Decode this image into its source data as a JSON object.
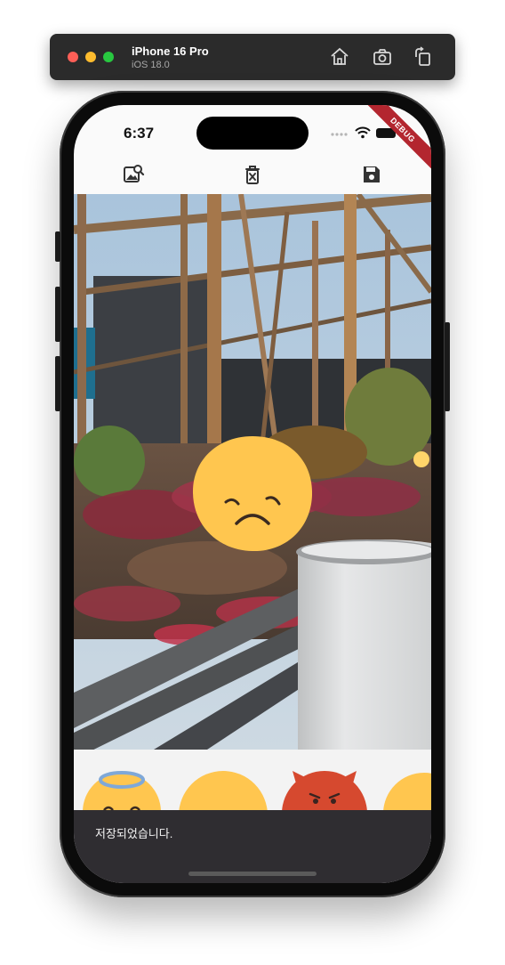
{
  "simulator": {
    "device_name": "iPhone 16 Pro",
    "os_version": "iOS 18.0",
    "home_icon": "home-icon",
    "screenshot_icon": "camera-icon",
    "rotate_icon": "rotate-icon"
  },
  "status_bar": {
    "time": "6:37",
    "debug_banner": "DEBUG"
  },
  "toolbar": {
    "pick_image_icon": "image-search-icon",
    "delete_icon": "delete-icon",
    "save_icon": "save-icon"
  },
  "editor": {
    "sticker": "sad-face-emoji"
  },
  "sticker_tray": {
    "items": [
      "angel-emoji",
      "smile-emoji",
      "devil-emoji",
      "emoji"
    ]
  },
  "snackbar": {
    "message": "저장되었습니다."
  }
}
